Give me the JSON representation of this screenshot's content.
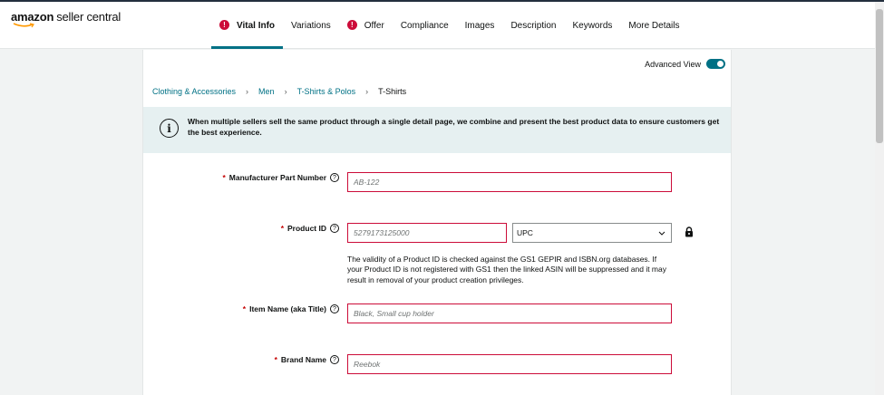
{
  "header": {
    "logo_bold": "amazon",
    "logo_rest": "seller central",
    "tabs": [
      {
        "label": "Vital Info",
        "alert": true
      },
      {
        "label": "Variations",
        "alert": false
      },
      {
        "label": "Offer",
        "alert": true
      },
      {
        "label": "Compliance",
        "alert": false
      },
      {
        "label": "Images",
        "alert": false
      },
      {
        "label": "Description",
        "alert": false
      },
      {
        "label": "Keywords",
        "alert": false
      },
      {
        "label": "More Details",
        "alert": false
      }
    ],
    "alert_glyph": "!"
  },
  "advanced_view": {
    "label": "Advanced View",
    "enabled": true
  },
  "breadcrumb": [
    "Clothing & Accessories",
    "Men",
    "T-Shirts & Polos",
    "T-Shirts"
  ],
  "breadcrumb_sep": "›",
  "info": {
    "icon": "i",
    "text": "When multiple sellers sell the same product through a single detail page, we combine and present the best product data to ensure customers get the best experience."
  },
  "form": {
    "required_mark": "*",
    "help_glyph": "?",
    "manufacturer_part_number": {
      "label": "Manufacturer Part Number",
      "placeholder": "AB-122"
    },
    "product_id": {
      "label": "Product ID",
      "placeholder": "5279173125000",
      "type_value": "UPC",
      "note": "The validity of a Product ID is checked against the GS1 GEPIR and ISBN.org databases. If your Product ID is not registered with GS1 then the linked ASIN will be suppressed and it may result in removal of your product creation privileges."
    },
    "item_name": {
      "label": "Item Name (aka Title)",
      "placeholder": "Black, Small cup holder"
    },
    "brand_name": {
      "label": "Brand Name",
      "placeholder": "Reebok"
    }
  },
  "colors": {
    "accent": "#007185",
    "error": "#cc0c39",
    "info_bg": "#e6f0f1"
  }
}
